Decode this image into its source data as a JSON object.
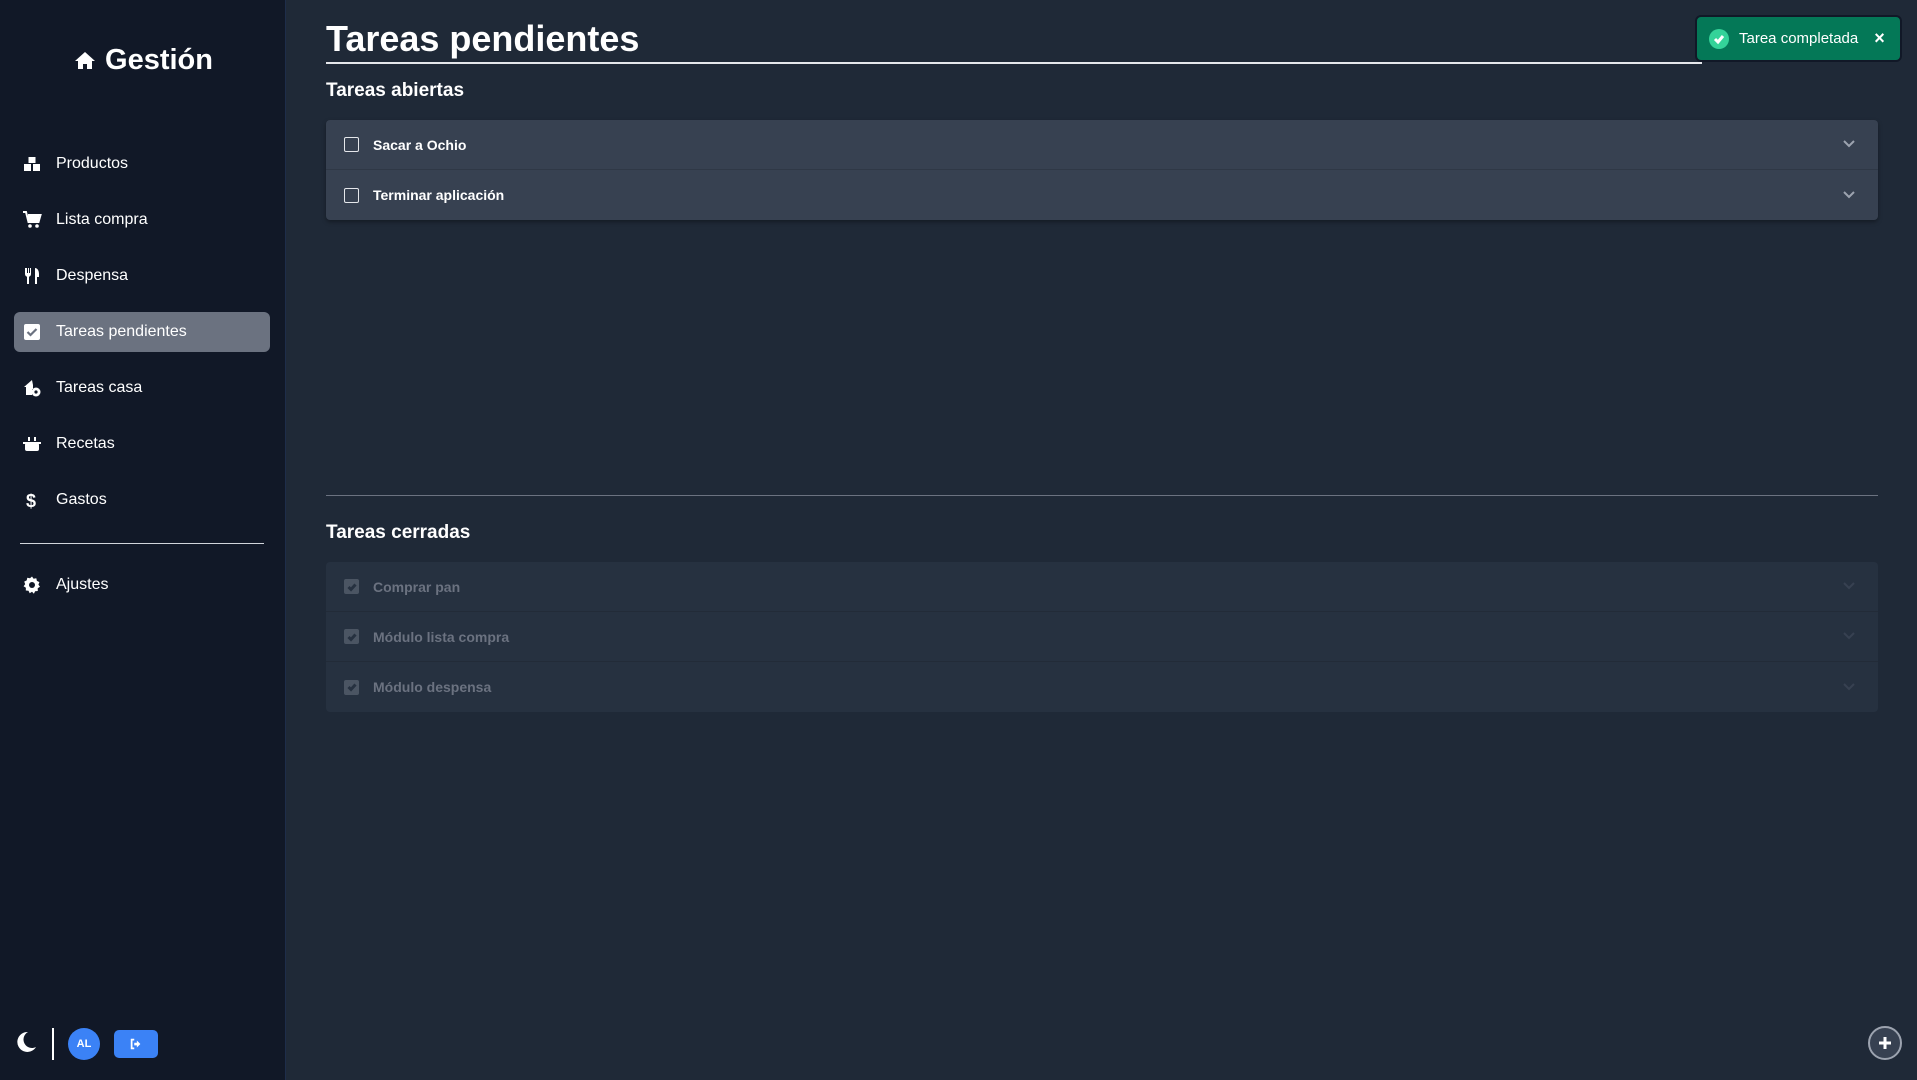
{
  "sidebar": {
    "brand": "Gestión",
    "items": [
      {
        "label": "Productos",
        "icon": "boxes-icon",
        "active": false
      },
      {
        "label": "Lista compra",
        "icon": "cart-icon",
        "active": false
      },
      {
        "label": "Despensa",
        "icon": "utensils-icon",
        "active": false
      },
      {
        "label": "Tareas pendientes",
        "icon": "check-square-icon",
        "active": true
      },
      {
        "label": "Tareas casa",
        "icon": "house-gear-icon",
        "active": false
      },
      {
        "label": "Recetas",
        "icon": "pot-icon",
        "active": false
      },
      {
        "label": "Gastos",
        "icon": "dollar-icon",
        "active": false
      }
    ],
    "settings": {
      "label": "Ajustes",
      "icon": "gear-icon"
    },
    "user_initials": "AL"
  },
  "main": {
    "title": "Tareas pendientes",
    "open_section_title": "Tareas abiertas",
    "open_tasks": [
      "Sacar a Ochio",
      "Terminar aplicación"
    ],
    "closed_section_title": "Tareas cerradas",
    "closed_tasks": [
      "Comprar pan",
      "Módulo lista compra",
      "Módulo despensa"
    ]
  },
  "toast": {
    "message": "Tarea completada",
    "close_label": "×"
  },
  "colors": {
    "sidebar_bg": "#111827",
    "main_bg": "#1f2937",
    "active_item": "#6b7280",
    "accent": "#3b82f6",
    "toast_bg": "#047857"
  }
}
